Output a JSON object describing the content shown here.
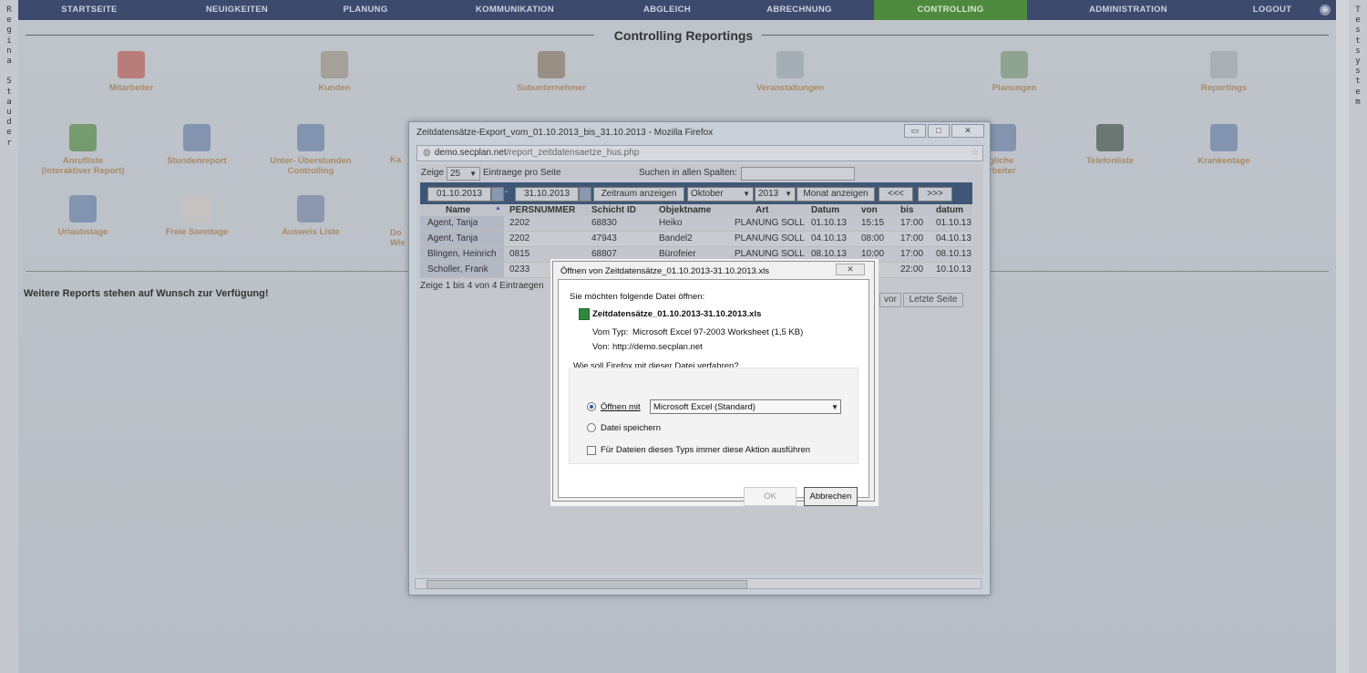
{
  "left_vertical": [
    "R",
    "e",
    "g",
    "i",
    "n",
    "a",
    "",
    "S",
    "t",
    "a",
    "u",
    "d",
    "e",
    "r"
  ],
  "right_vertical": [
    "T",
    "e",
    "s",
    "t",
    "s",
    "y",
    "s",
    "t",
    "e",
    "m"
  ],
  "nav": {
    "items": [
      "STARTSEITE",
      "NEUIGKEITEN",
      "PLANUNG",
      "KOMMUNIKATION",
      "ABGLEICH",
      "ABRECHNUNG",
      "CONTROLLING",
      "ADMINISTRATION",
      "LOGOUT"
    ],
    "active": "CONTROLLING",
    "globe": "⊕"
  },
  "page": {
    "title": "Controlling Reportings",
    "row1": [
      "Mitarbeiter",
      "Kunden",
      "Subunternehmer",
      "Veranstaltungen",
      "Planungen",
      "Reportings"
    ],
    "row2": [
      "Anrufliste",
      "(interaktiver Report)",
      "Stundenreport",
      "Unter- Überstunden",
      "Controlling",
      "Ka",
      "gliche",
      "rbeiter",
      "Telefonliste",
      "Krankentage"
    ],
    "row3": [
      "Urlaubstage",
      "Freie Sonntage",
      "Ausweis Liste",
      "Do",
      "Wie"
    ],
    "more_reports": "Weitere Reports stehen auf Wunsch zur Verfügung!"
  },
  "firefox": {
    "title": "Zeitdatensätze-Export_vom_01.10.2013_bis_31.10.2013 - Mozilla Firefox",
    "url_domain": "demo.secplan.net",
    "url_path": "/report_zeitdatensaetze_hus.php",
    "controls": {
      "min": "▭",
      "max": "□",
      "close": "✕"
    },
    "show_label": "Zeige",
    "page_size": "25",
    "per_page_label": "Eintraege pro Seite",
    "search_label": "Suchen in allen Spalten:",
    "date_from": "01.10.2013",
    "date_sep": "-",
    "date_to": "31.10.2013",
    "btn_range": "Zeitraum anzeigen",
    "month": "Oktober",
    "year": "2013",
    "btn_month": "Monat anzeigen",
    "btn_prev": "<<<",
    "btn_next": ">>>",
    "columns": [
      "Name",
      "PERSNUMMER",
      "Schicht ID",
      "Objektname",
      "Art",
      "Datum",
      "von",
      "bis",
      "datum"
    ],
    "rows": [
      [
        "Agent, Tanja",
        "2202",
        "68830",
        "Heiko",
        "PLANUNG SOLL",
        "01.10.13",
        "15:15",
        "17:00",
        "01.10.13"
      ],
      [
        "Agent, Tanja",
        "2202",
        "47943",
        "Bandel2",
        "PLANUNG SOLL",
        "04.10.13",
        "08:00",
        "17:00",
        "04.10.13"
      ],
      [
        "Blingen, Heinrich",
        "0815",
        "68807",
        "Bürofeier",
        "PLANUNG SOLL",
        "08.10.13",
        "10:00",
        "17:00",
        "08.10.13"
      ],
      [
        "Scholler, Frank",
        "0233",
        "",
        "",
        "",
        "",
        "00",
        "22:00",
        "10.10.13"
      ]
    ],
    "info": "Zeige 1 bis 4 von 4 Eintraegen",
    "btn_vor": "vor",
    "btn_last": "Letzte Seite"
  },
  "dialog": {
    "title": "Öffnen von Zeitdatensätze_01.10.2013-31.10.2013.xls",
    "close": "✕",
    "intro": "Sie möchten folgende Datei öffnen:",
    "filename": "Zeitdatensätze_01.10.2013-31.10.2013.xls",
    "type_label": "Vom Typ:",
    "type_value": "Microsoft Excel 97-2003 Worksheet (1,5 KB)",
    "from_label": "Von:",
    "from_value": "http://demo.secplan.net",
    "question": "Wie soll Firefox mit dieser Datei verfahren?",
    "open_with_label": "Öffnen mit",
    "open_with_value": "Microsoft Excel (Standard)",
    "save_label": "Datei speichern",
    "always_label": "Für Dateien dieses Typs immer diese Aktion ausführen",
    "ok": "OK",
    "cancel": "Abbrechen"
  }
}
